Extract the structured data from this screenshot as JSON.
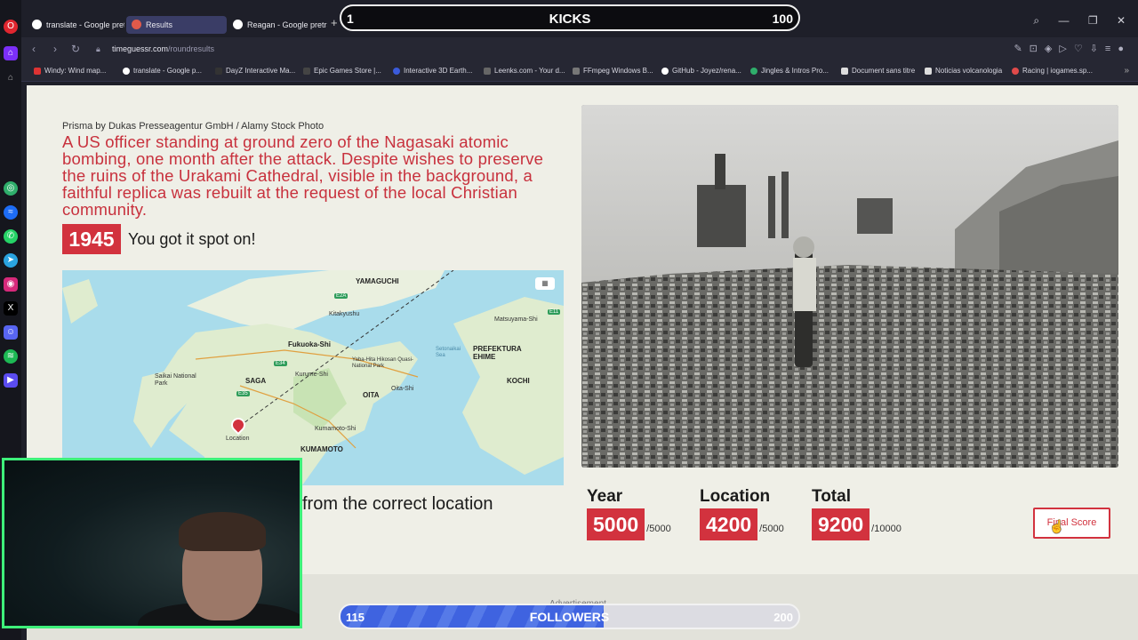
{
  "browser": {
    "tabs": [
      {
        "label": "translate - Google pretraž",
        "active": false
      },
      {
        "label": "Results",
        "active": true
      },
      {
        "label": "Reagan - Google pretraživ",
        "active": false
      }
    ],
    "url_host": "timeguessr.com",
    "url_path": "/roundresults",
    "bookmarks": [
      "Windy: Wind map...",
      "translate - Google p...",
      "DayZ Interactive Ma...",
      "Epic Games Store |...",
      "Interactive 3D Earth...",
      "Leenks.com - Your d...",
      "FFmpeg Windows B...",
      "GitHub - Joyez/rena...",
      "Jingles & Intros Pro...",
      "Document sans titre",
      "Noticias volcanologia",
      "Racing | iogames.sp..."
    ]
  },
  "overlay": {
    "kicks": {
      "current": "1",
      "label": "KICKS",
      "goal": "100"
    },
    "followers": {
      "current": "115",
      "label": "FOLLOWERS",
      "goal": "200",
      "progress_fraction": 0.575
    }
  },
  "result": {
    "photo_credit": "Prisma by Dukas Presseagentur GmbH / Alamy Stock Photo",
    "caption": "A US officer standing at ground zero of the Nagasaki atomic bombing, one month after the attack. Despite wishes to preserve the ruins of the Urakami Cathedral, visible in the background, a faithful replica was rebuilt at the request of the local Christian community.",
    "year": "1945",
    "year_message": "You got it spot on!",
    "distance_message": "from the correct location",
    "map": {
      "labels": {
        "yamaguchi": "YAMAGUCHI",
        "kitakyushu": "Kitakyushu",
        "fukuoka": "Fukuoka-Shi",
        "saga": "SAGA",
        "kurume": "Kurume-Shi",
        "oita": "OITA",
        "oita_shi": "Oita-Shi",
        "kumamoto_shi": "Kumamoto-Shi",
        "kumamoto": "KUMAMOTO",
        "matsuyama": "Matsuyama-Shi",
        "ehime": "PREFEKTURA EHIME",
        "kochi": "KOCHI",
        "saikai": "Saikai National Park",
        "yaba": "Yaba-Hita Hikosan Quasi-National Park",
        "seto": "Setonaikai Sea",
        "pin_label": "Location"
      }
    },
    "scores": {
      "year": {
        "title": "Year",
        "value": "5000",
        "max": "/5000"
      },
      "location": {
        "title": "Location",
        "value": "4200",
        "max": "/5000"
      },
      "total": {
        "title": "Total",
        "value": "9200",
        "max": "/10000"
      }
    },
    "final_button": "Final Score",
    "ad_label": "Advertisement"
  },
  "colors": {
    "accent": "#d2323e",
    "webcam_border": "#3ef07a",
    "follower_fill": "#3f63e0"
  }
}
